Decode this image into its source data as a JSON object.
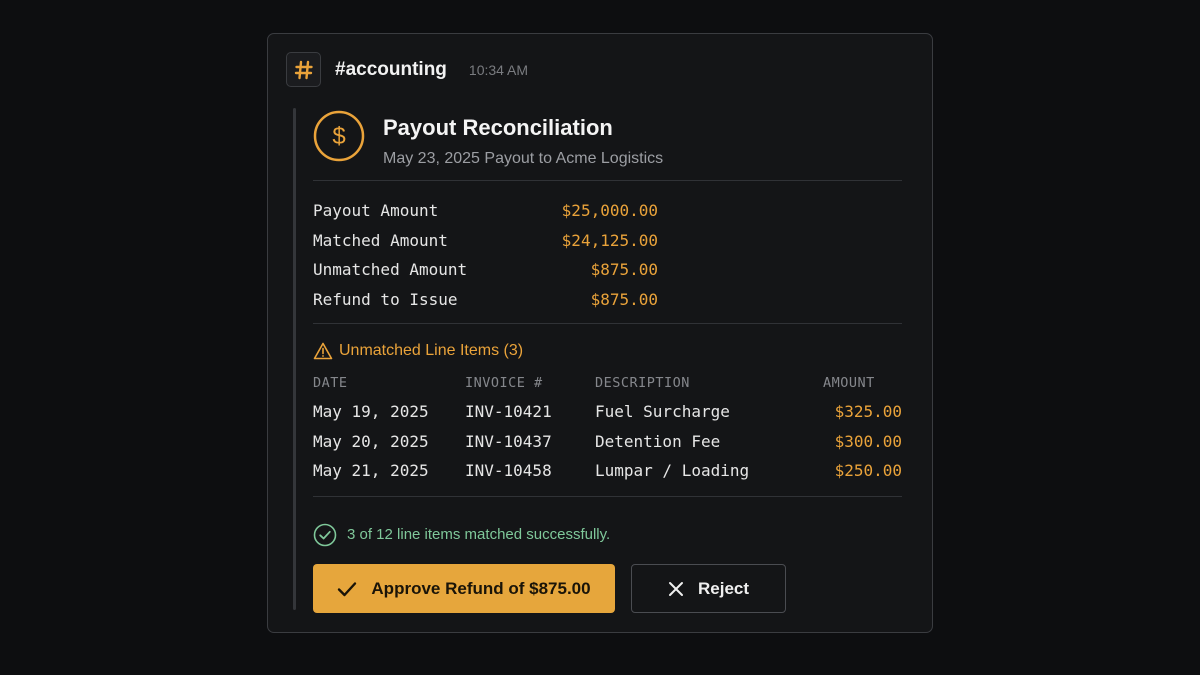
{
  "header": {
    "channel": "#accounting",
    "time": "10:34 AM",
    "icon": "hash-icon"
  },
  "card": {
    "title": "Payout Reconciliation",
    "subtitle": "May 23, 2025 Payout to Acme Logistics",
    "icon": "dollar-icon"
  },
  "summary": [
    {
      "label": "Payout Amount",
      "value": "$25,000.00"
    },
    {
      "label": "Matched Amount",
      "value": "$24,125.00"
    },
    {
      "label": "Unmatched Amount",
      "value": "$875.00"
    },
    {
      "label": "Refund to Issue",
      "value": "$875.00"
    }
  ],
  "unmatched": {
    "title": "Unmatched Line Items (3)",
    "columns": [
      "DATE",
      "INVOICE #",
      "DESCRIPTION",
      "AMOUNT"
    ],
    "rows": [
      {
        "date": "May 19, 2025",
        "invoice": "INV-10421",
        "description": "Fuel Surcharge",
        "amount": "$325.00"
      },
      {
        "date": "May 20, 2025",
        "invoice": "INV-10437",
        "description": "Detention Fee",
        "amount": "$300.00"
      },
      {
        "date": "May 21, 2025",
        "invoice": "INV-10458",
        "description": "Lumpar / Loading",
        "amount": "$250.00"
      }
    ]
  },
  "status": {
    "text": "3 of 12 line items matched successfully."
  },
  "actions": {
    "approve_label": "Approve Refund of $875.00",
    "reject_label": "Reject"
  },
  "colors": {
    "accent": "#eaa33a",
    "success": "#7fc89a",
    "background": "#0d0e10",
    "card": "#141517"
  }
}
